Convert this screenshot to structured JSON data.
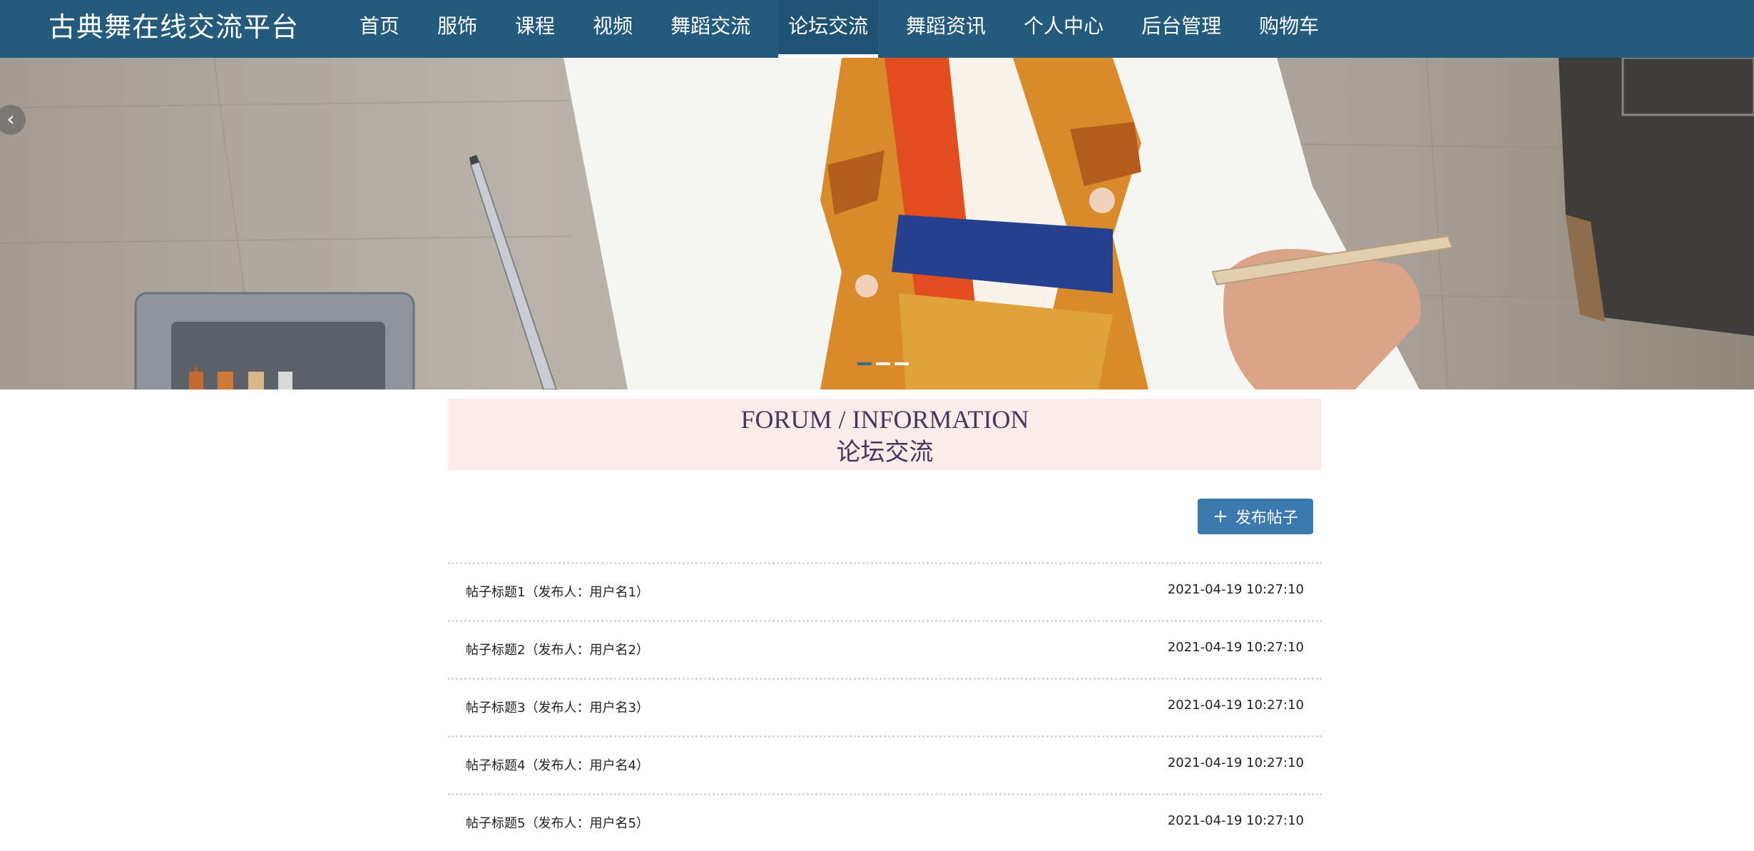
{
  "header": {
    "brand": "古典舞在线交流平台",
    "nav": [
      {
        "label": "首页",
        "active": false
      },
      {
        "label": "服饰",
        "active": false
      },
      {
        "label": "课程",
        "active": false
      },
      {
        "label": "视频",
        "active": false
      },
      {
        "label": "舞蹈交流",
        "active": false
      },
      {
        "label": "论坛交流",
        "active": true
      },
      {
        "label": "舞蹈资讯",
        "active": false
      },
      {
        "label": "个人中心",
        "active": false
      },
      {
        "label": "后台管理",
        "active": false
      },
      {
        "label": "购物车",
        "active": false
      }
    ]
  },
  "banner": {
    "prev_icon": "chevron-left-icon",
    "slide_count": 3,
    "active_slide": 0
  },
  "section": {
    "title_en": "FORUM / INFORMATION",
    "title_cn": "论坛交流"
  },
  "actions": {
    "publish_label": "发布帖子",
    "publish_icon": "plus-icon"
  },
  "posts": [
    {
      "title": "帖子标题1（发布人：用户名1）",
      "time": "2021-04-19 10:27:10"
    },
    {
      "title": "帖子标题2（发布人：用户名2）",
      "time": "2021-04-19 10:27:10"
    },
    {
      "title": "帖子标题3（发布人：用户名3）",
      "time": "2021-04-19 10:27:10"
    },
    {
      "title": "帖子标题4（发布人：用户名4）",
      "time": "2021-04-19 10:27:10"
    },
    {
      "title": "帖子标题5（发布人：用户名5）",
      "time": "2021-04-19 10:27:10"
    }
  ],
  "colors": {
    "nav_bg": "#245a7c",
    "heading_bg": "#faece8",
    "heading_text": "#47365e",
    "button_bg": "#3b78ad"
  }
}
